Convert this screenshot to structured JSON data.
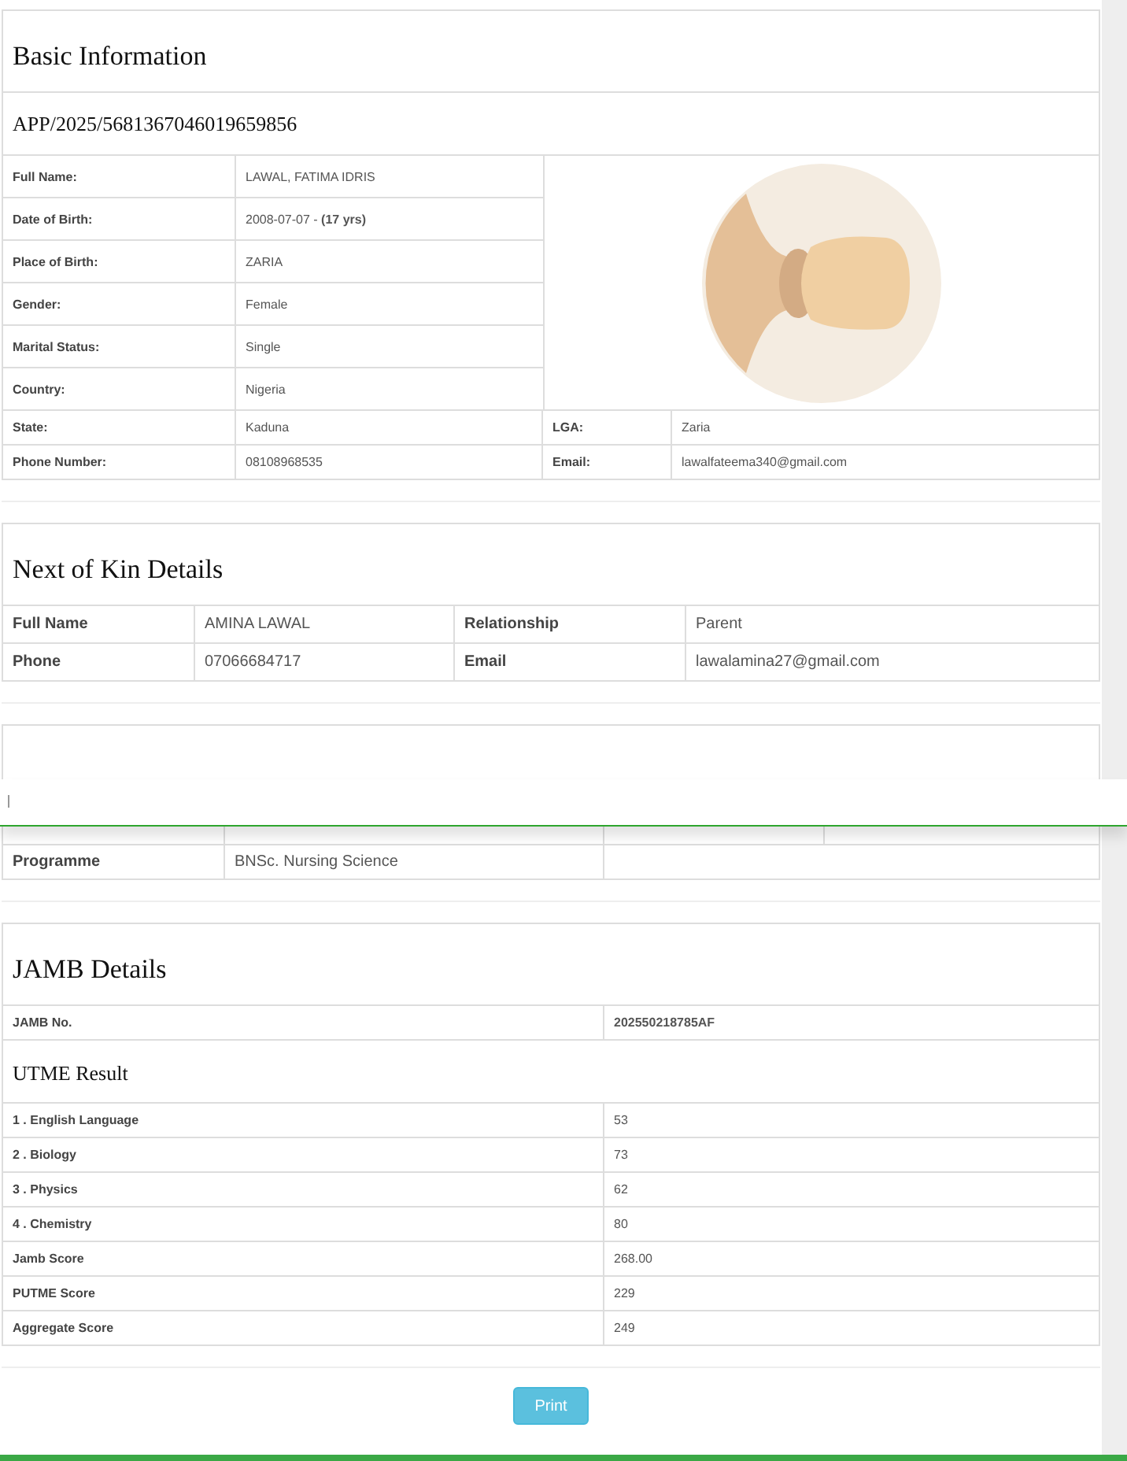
{
  "basic_info": {
    "title": "Basic Information",
    "application_no": "APP/2025/5681367046019659856",
    "fields": [
      {
        "label": "Full Name:",
        "value": "LAWAL, FATIMA IDRIS"
      },
      {
        "label": "Date of Birth:",
        "value": "2008-07-07 - **(17 yrs)**"
      },
      {
        "label": "Place of Birth:",
        "value": "ZARIA"
      },
      {
        "label": "Gender:",
        "value": "Female"
      },
      {
        "label": "Marital Status:",
        "value": "Single"
      },
      {
        "label": "Country:",
        "value": "Nigeria"
      }
    ],
    "pairs": [
      {
        "label": "State:",
        "value": "Kaduna",
        "label_2": "LGA:",
        "value_2": "Zaria"
      },
      {
        "label": "Phone Number:",
        "value": "08108968535",
        "label_2": "Email:",
        "value_2": "lawalfateema340@gmail.com"
      }
    ]
  },
  "next_of_kin": {
    "title": "Next of Kin Details",
    "rows": [
      {
        "label": "Full Name",
        "value": "AMINA LAWAL",
        "label_2": "Relationship",
        "value_2": "Parent"
      },
      {
        "label": "Phone",
        "value": "07066684717",
        "label_2": "Email",
        "value_2": "lawalamina27@gmail.com"
      }
    ]
  },
  "programme": {
    "rows": [
      {
        "label": "Programme",
        "value": "BNSc. Nursing Science"
      }
    ]
  },
  "jamb": {
    "title": "JAMB Details",
    "jamb_no_label": "JAMB No.",
    "jamb_no": "202550218785AF",
    "utme_title": "UTME Result",
    "results": [
      {
        "subject": "1 . English Language",
        "score": "53"
      },
      {
        "subject": "2 . Biology",
        "score": "73"
      },
      {
        "subject": "3 . Physics",
        "score": "62"
      },
      {
        "subject": "4 . Chemistry",
        "score": "80"
      },
      {
        "subject": "Jamb Score",
        "score": "268.00"
      },
      {
        "subject": "PUTME Score",
        "score": "229"
      },
      {
        "subject": "Aggregate Score",
        "score": "249"
      }
    ]
  },
  "print_button": "Print"
}
